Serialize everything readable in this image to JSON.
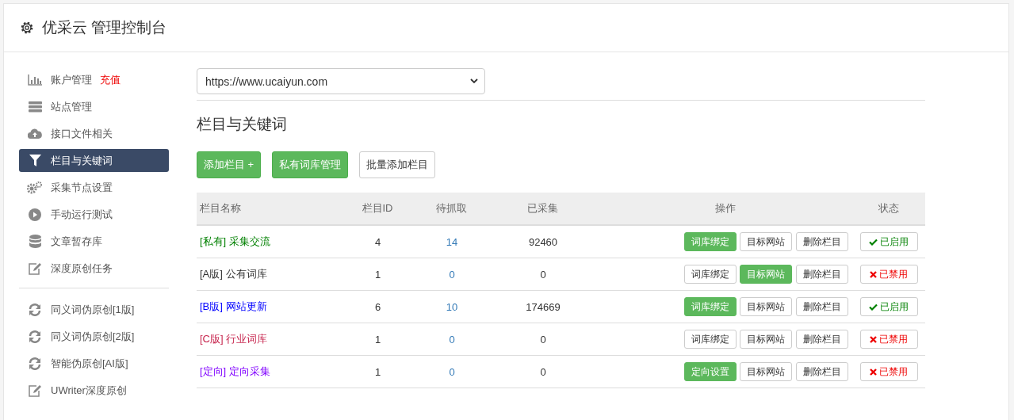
{
  "header": {
    "title": "优采云 管理控制台"
  },
  "sidebar": {
    "items": [
      {
        "label": "账户管理",
        "badge": "充值",
        "selected": false
      },
      {
        "label": "站点管理",
        "selected": false
      },
      {
        "label": "接口文件相关",
        "selected": false
      },
      {
        "label": "栏目与关键词",
        "selected": true
      },
      {
        "label": "采集节点设置",
        "selected": false
      },
      {
        "label": "手动运行测试",
        "selected": false
      },
      {
        "label": "文章暂存库",
        "selected": false
      },
      {
        "label": "深度原创任务",
        "selected": false
      },
      {
        "kind": "divider"
      },
      {
        "label": "同义词伪原创[1版]",
        "selected": false
      },
      {
        "label": "同义词伪原创[2版]",
        "selected": false
      },
      {
        "label": "智能伪原创[AI版]",
        "selected": false
      },
      {
        "label": "UWriter深度原创",
        "selected": false
      }
    ]
  },
  "site_select": {
    "value": "https://www.ucaiyun.com"
  },
  "section_title": "栏目与关键词",
  "toolbar": [
    {
      "label": "添加栏目 +",
      "primary": true
    },
    {
      "label": "私有词库管理",
      "primary": true
    },
    {
      "label": "批量添加栏目",
      "primary": false
    }
  ],
  "table": {
    "columns": [
      "栏目名称",
      "栏目ID",
      "待抓取",
      "已采集",
      "操作",
      "状态"
    ],
    "rows": [
      {
        "tag": "[私有]",
        "name": "采集交流",
        "color": "#008000",
        "id": "4",
        "pending": "14",
        "collected": "92460",
        "actions": [
          {
            "label": "词库绑定",
            "primary": true
          },
          {
            "label": "目标网站",
            "primary": false
          },
          {
            "label": "删除栏目",
            "primary": false
          }
        ],
        "status": {
          "label": "已启用",
          "enabled": true
        }
      },
      {
        "tag": "[A版]",
        "name": "公有词库",
        "color": "#333333",
        "id": "1",
        "pending": "0",
        "collected": "0",
        "actions": [
          {
            "label": "词库绑定",
            "primary": false
          },
          {
            "label": "目标网站",
            "primary": true
          },
          {
            "label": "删除栏目",
            "primary": false
          }
        ],
        "status": {
          "label": "已禁用",
          "enabled": false
        }
      },
      {
        "tag": "[B版]",
        "name": "网站更新",
        "color": "#0000ff",
        "id": "6",
        "pending": "10",
        "collected": "174669",
        "actions": [
          {
            "label": "词库绑定",
            "primary": true
          },
          {
            "label": "目标网站",
            "primary": false
          },
          {
            "label": "删除栏目",
            "primary": false
          }
        ],
        "status": {
          "label": "已启用",
          "enabled": true
        }
      },
      {
        "tag": "[C版]",
        "name": "行业词库",
        "color": "#c7254e",
        "id": "1",
        "pending": "0",
        "collected": "0",
        "actions": [
          {
            "label": "词库绑定",
            "primary": false
          },
          {
            "label": "目标网站",
            "primary": false
          },
          {
            "label": "删除栏目",
            "primary": false
          }
        ],
        "status": {
          "label": "已禁用",
          "enabled": false
        }
      },
      {
        "tag": "[定向]",
        "name": "定向采集",
        "color": "#8000ff",
        "id": "1",
        "pending": "0",
        "collected": "0",
        "actions": [
          {
            "label": "定向设置",
            "primary": true
          },
          {
            "label": "目标网站",
            "primary": false
          },
          {
            "label": "删除栏目",
            "primary": false
          }
        ],
        "status": {
          "label": "已禁用",
          "enabled": false
        }
      }
    ]
  }
}
